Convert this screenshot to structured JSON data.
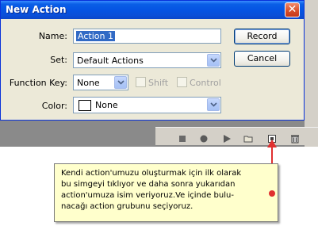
{
  "dialog": {
    "title": "New Action",
    "close_glyph": "✕",
    "name": {
      "label": "Name:",
      "value": "Action 1"
    },
    "set": {
      "label": "Set:",
      "value": "Default Actions"
    },
    "function_key": {
      "label": "Function Key:",
      "value": "None",
      "shift_label": "Shift",
      "control_label": "Control"
    },
    "color": {
      "label": "Color:",
      "value": "None"
    },
    "buttons": {
      "record": "Record",
      "cancel": "Cancel"
    }
  },
  "actions_panel": {
    "toolbar_icons": [
      "stop-icon",
      "record-icon",
      "play-icon",
      "new-set-folder-icon",
      "new-action-icon",
      "trash-icon"
    ]
  },
  "callout": {
    "text": "Kendi action'umuzu oluşturmak için ilk olarak\nbu simgeyi tıklıyor ve daha sonra yukarıdan\naction'umuza isim veriyoruz.Ve içinde bulu-\nnacağı action grubunu seçiyoruz.",
    "pointer_color": "#e03030"
  },
  "colors": {
    "titlebar": "#0554e3",
    "dialog_bg": "#ece9d8",
    "selection": "#316ac5",
    "callout_bg": "#ffffcc"
  }
}
